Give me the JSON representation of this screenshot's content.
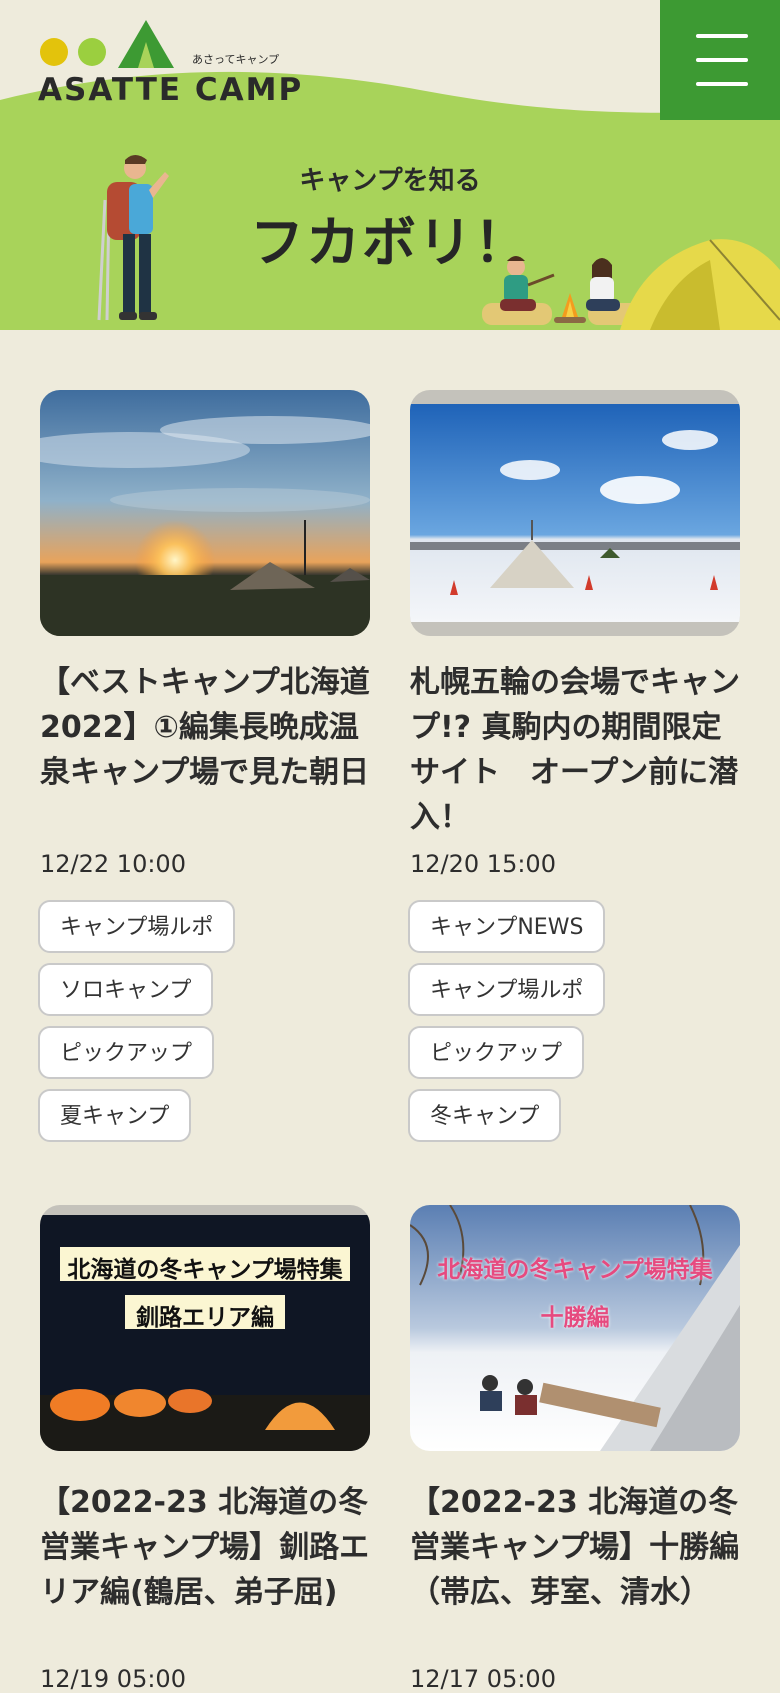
{
  "header": {
    "logo_text": "ASATTE CAMP",
    "logo_sub": "あさってキャンプ",
    "menu_icon": "hamburger-icon",
    "hero_subtitle": "キャンプを知る",
    "hero_title": "フカボリ！"
  },
  "colors": {
    "background": "#eeebdc",
    "hero_green": "#a8d35a",
    "menu_green": "#3d9a33",
    "logo_yellow": "#e3c30c",
    "logo_green": "#9bcf3f"
  },
  "articles": [
    {
      "title": "【ベストキャンプ北海道2022】①編集長晩成温泉キャンプ場で見た朝日",
      "date": "12/22 10:00",
      "tags": [
        "キャンプ場ルポ",
        "ソロキャンプ",
        "ピックアップ",
        "夏キャンプ"
      ]
    },
    {
      "title": "札幌五輪の会場でキャンプ!? 真駒内の期間限定サイト　オープン前に潜入！",
      "date": "12/20 15:00",
      "tags": [
        "キャンプNEWS",
        "キャンプ場ルポ",
        "ピックアップ",
        "冬キャンプ"
      ]
    },
    {
      "title": "【2022-23 北海道の冬営業キャンプ場】釧路エリア編(鶴居、弟子屈)",
      "date": "12/19 05:00",
      "thumb_caption_1": "北海道の冬キャンプ場特集",
      "thumb_caption_2": "釧路エリア編"
    },
    {
      "title": "【2022-23 北海道の冬営業キャンプ場】十勝編（帯広、芽室、清水）",
      "date": "12/17 05:00",
      "thumb_caption_1": "北海道の冬キャンプ場特集",
      "thumb_caption_2": "十勝編"
    }
  ]
}
